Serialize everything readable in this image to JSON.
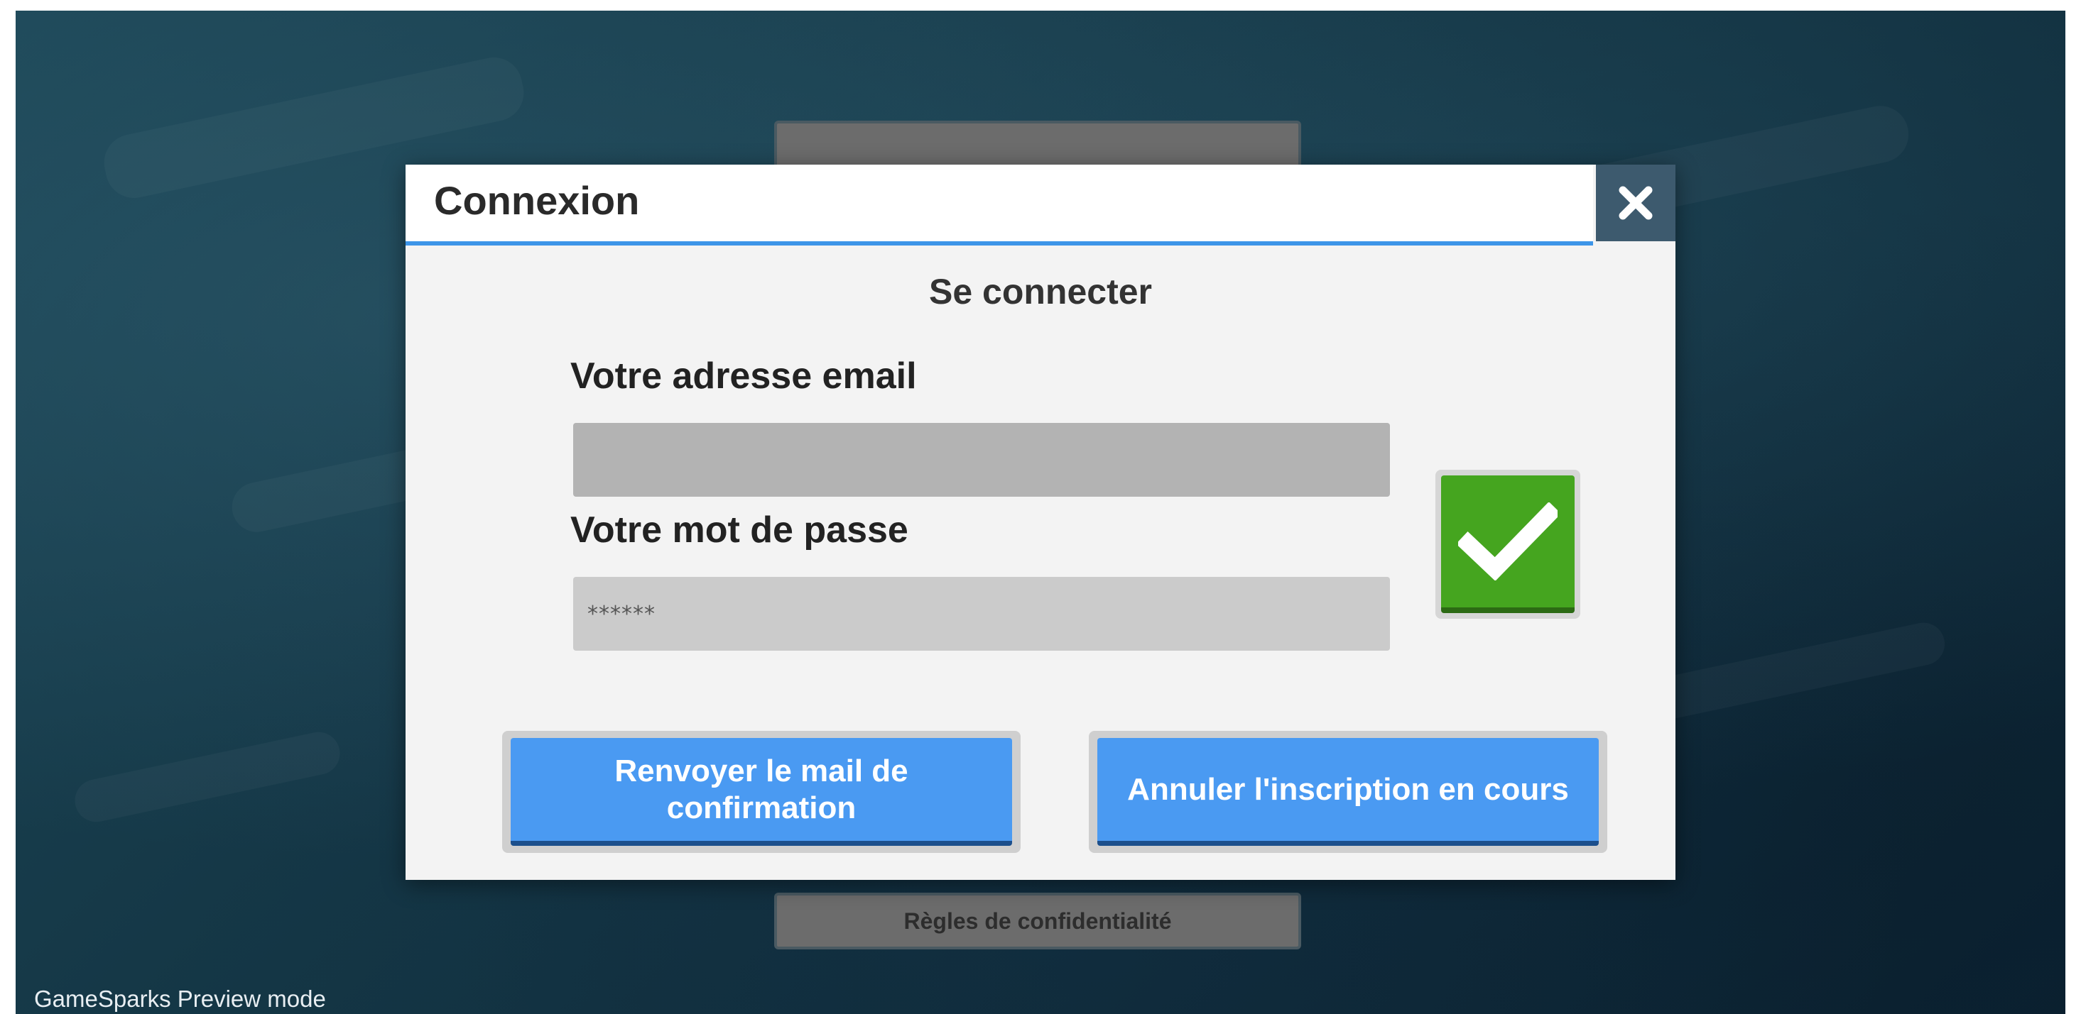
{
  "background": {
    "menu_top_label": "",
    "menu_mid_label": "",
    "privacy_label": "Règles de confidentialité",
    "preview_mode_label": "GameSparks Preview mode"
  },
  "dialog": {
    "title": "Connexion",
    "close_icon": "close-icon",
    "subtitle": "Se connecter",
    "email": {
      "label": "Votre adresse email",
      "value": "",
      "placeholder": ""
    },
    "password": {
      "label": "Votre mot de passe",
      "value": "******",
      "placeholder": ""
    },
    "confirm_icon": "checkmark-icon",
    "buttons": {
      "resend_label": "Renvoyer le mail de confirmation",
      "cancel_signup_label": "Annuler l'inscription en cours"
    }
  },
  "colors": {
    "accent_blue": "#3d95e8",
    "button_blue": "#4a9af2",
    "confirm_green": "#45a51f",
    "close_bg": "#3d5a6e"
  }
}
